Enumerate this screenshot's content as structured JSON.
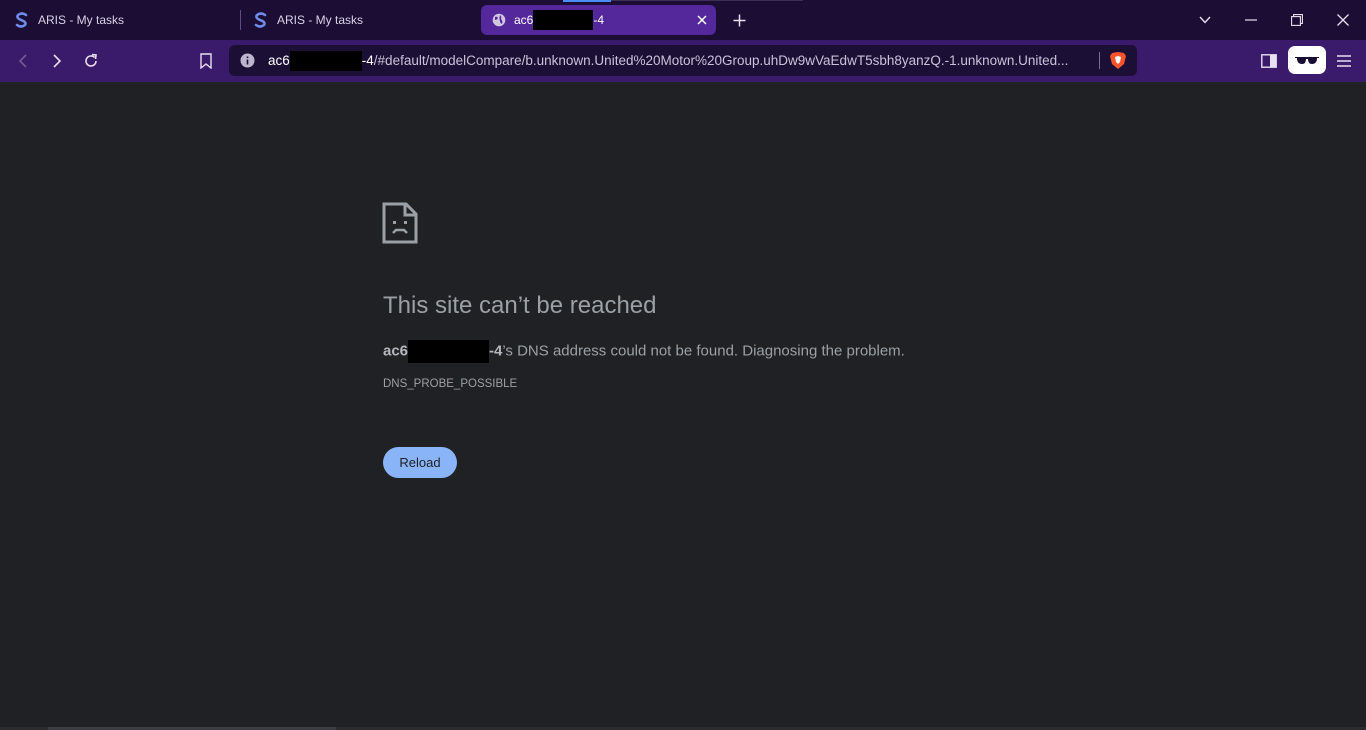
{
  "tabs": [
    {
      "title": "ARIS - My tasks"
    },
    {
      "title": "ARIS - My tasks"
    }
  ],
  "active_tab": {
    "prefix": "ac6",
    "suffix": "-4"
  },
  "address": {
    "host_prefix": "ac6",
    "host_suffix": "-4",
    "path": "/#default/modelCompare/b.unknown.United%20Motor%20Group.uhDw9wVaEdwT5sbh8yanzQ.-1.unknown.United..."
  },
  "error": {
    "title": "This site can’t be reached",
    "host_prefix": "ac6",
    "host_suffix": "-4",
    "message": "’s DNS address could not be found. Diagnosing the problem.",
    "code": "DNS_PROBE_POSSIBLE",
    "reload_label": "Reload"
  },
  "colors": {
    "tabbar_bg": "#1b0d33",
    "toolbar_bg": "#3a1a6b",
    "active_tab_bg": "#54279a",
    "page_bg": "#202124",
    "button_blue": "#8ab4f8"
  },
  "icons": [
    "aris-s-icon",
    "globe-icon",
    "close-icon",
    "plus-icon",
    "chevron-down-icon",
    "minimize-icon",
    "restore-icon",
    "back-icon",
    "forward-icon",
    "reload-icon",
    "bookmark-icon",
    "info-icon",
    "brave-shield-icon",
    "sidebar-icon",
    "glasses-icon",
    "menu-icon",
    "sad-page-icon"
  ]
}
